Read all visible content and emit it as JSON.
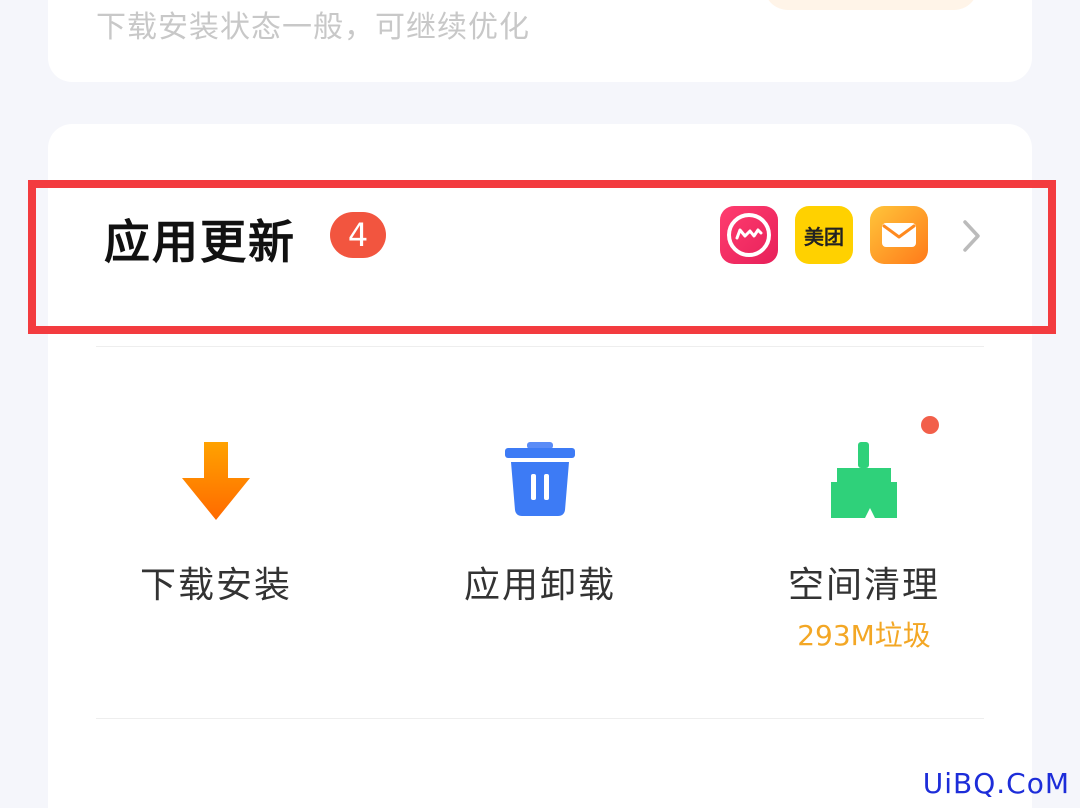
{
  "top_card": {
    "subtitle": "下载安装状态一般，可继续优化"
  },
  "update": {
    "title": "应用更新",
    "badge_count": "4",
    "apps": [
      {
        "name": "meitu-icon"
      },
      {
        "name": "meituan-icon",
        "label": "美团"
      },
      {
        "name": "mail-icon"
      }
    ]
  },
  "tools": [
    {
      "label": "下载安装",
      "icon": "download-arrow-icon"
    },
    {
      "label": "应用卸载",
      "icon": "trash-icon"
    },
    {
      "label": "空间清理",
      "icon": "broom-icon",
      "sub": "293M垃圾",
      "has_dot": true
    }
  ],
  "watermark": "UiBQ.CoM",
  "colors": {
    "badge": "#f2553f",
    "highlight": "#f33b3f",
    "junk_text": "#f3a725",
    "download": "#ff8a00",
    "trash": "#3d7bf5",
    "broom": "#2fd17a"
  }
}
